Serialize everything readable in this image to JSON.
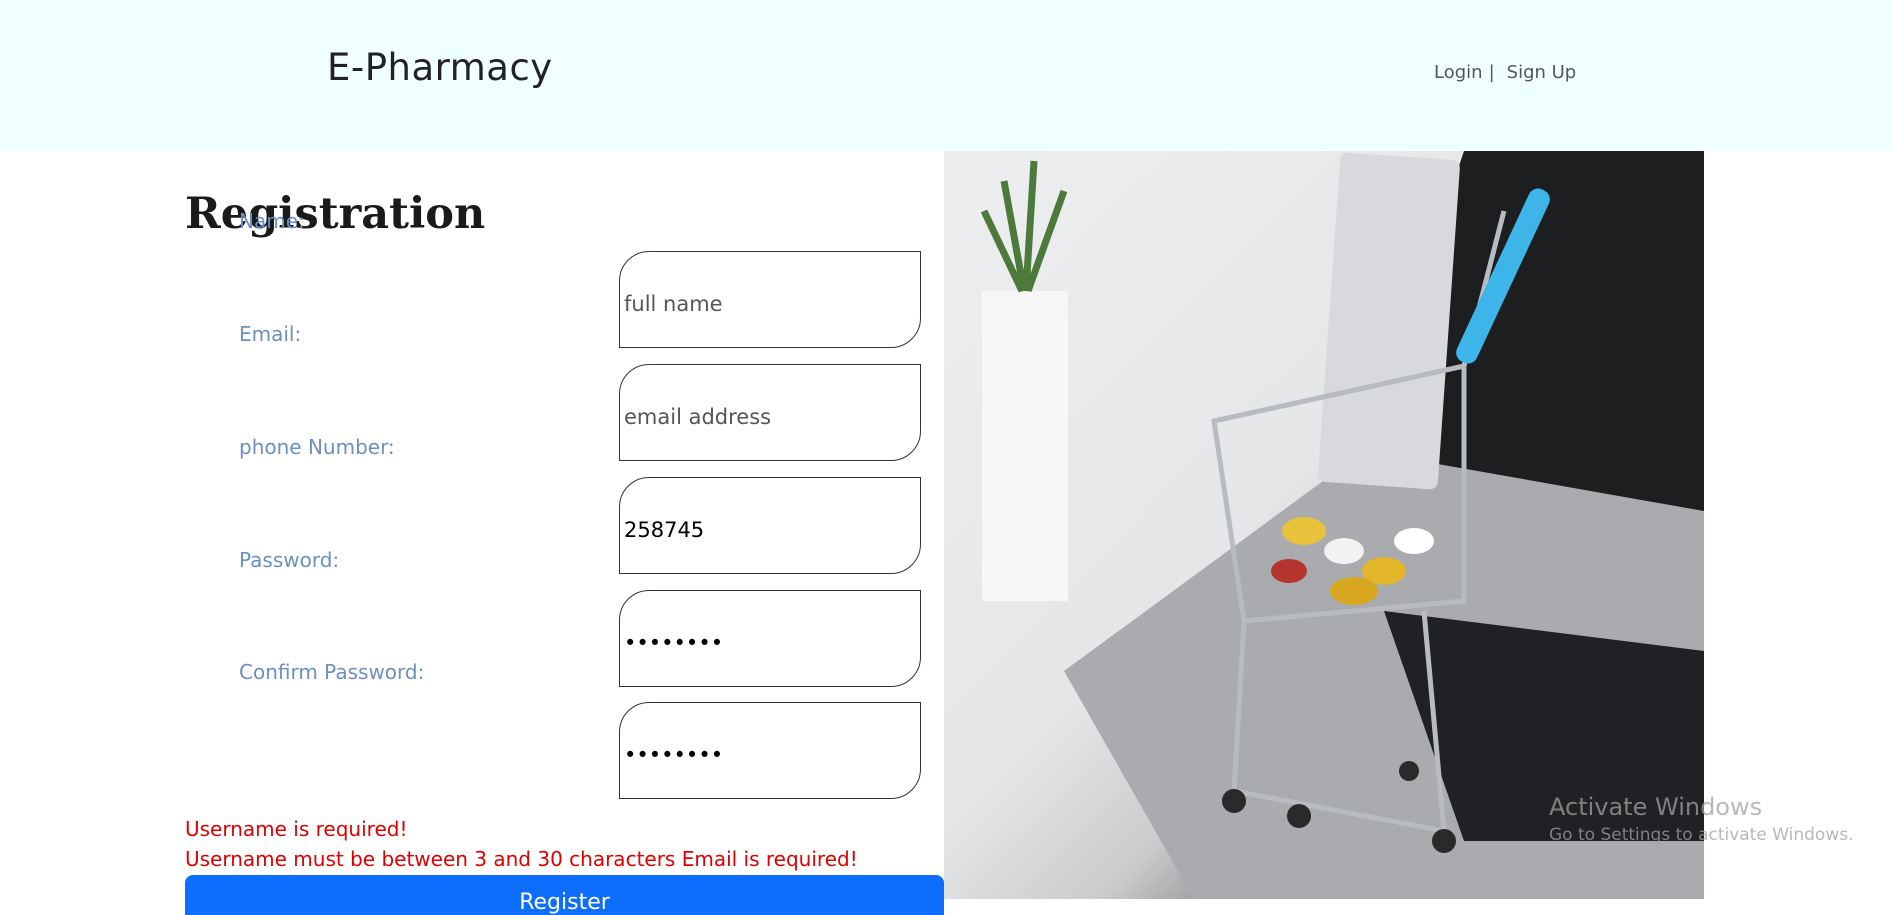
{
  "header": {
    "brand": "E-Pharmacy",
    "nav": {
      "login": "Login",
      "separator": "|",
      "signup": "Sign Up"
    }
  },
  "form": {
    "title": "Registration",
    "fields": [
      {
        "label": "Name:",
        "placeholder": "full name",
        "value": ""
      },
      {
        "label": "Email:",
        "placeholder": "email address",
        "value": ""
      },
      {
        "label": "phone Number:",
        "placeholder": "",
        "value": "258745"
      },
      {
        "label": "Password:",
        "placeholder": "",
        "value": "••••••••"
      },
      {
        "label": "Confirm Password:",
        "placeholder": "",
        "value": "••••••••"
      }
    ],
    "errors": [
      "Username is required!",
      "Username must be between 3 and 30 characters Email is required!"
    ],
    "submit_label": "Register"
  },
  "os_watermark": {
    "line1": "Activate Windows",
    "line2": "Go to Settings to activate Windows."
  },
  "colors": {
    "header_bg": "#f0ffff",
    "label": "#6b8fc4",
    "error": "#e00000",
    "primary_button": "#0d6efd"
  }
}
